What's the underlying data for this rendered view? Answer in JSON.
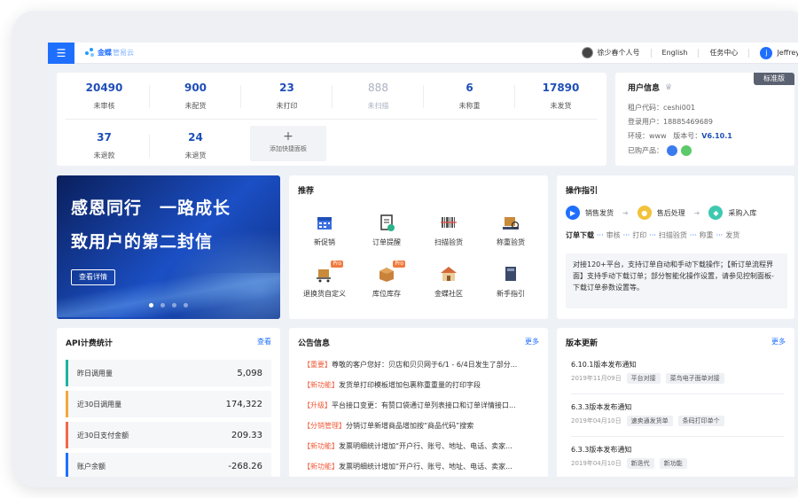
{
  "app": {
    "logo_main": "金蝶",
    "logo_sub": "管易云"
  },
  "topbar": {
    "user_name": "徐少春个人号",
    "language": "English",
    "task_center": "任务中心",
    "account_initial": "j",
    "account_name": "Jeffrey"
  },
  "stats": [
    {
      "value": "20490",
      "label": "未审核"
    },
    {
      "value": "900",
      "label": "未配货"
    },
    {
      "value": "23",
      "label": "未打印"
    },
    {
      "value": "888",
      "label": "未扫描"
    },
    {
      "value": "6",
      "label": "未称重"
    },
    {
      "value": "17890",
      "label": "未发货"
    },
    {
      "value": "37",
      "label": "未退款"
    },
    {
      "value": "24",
      "label": "未退货"
    }
  ],
  "add_panel": {
    "icon": "plus-icon",
    "label": "添加快捷面板"
  },
  "user_info": {
    "title": "用户信息",
    "edition": "标准版",
    "tenant_label": "租户代码：",
    "tenant": "ceshi001",
    "login_label": "登录用户：",
    "login": "18885469689",
    "env_label": "环境：",
    "env": "www",
    "version_label": "版本号：",
    "version": "V6.10.1",
    "products_label": "已购产品："
  },
  "banner": {
    "line1": "感恩同行　一路成长",
    "line2": "致用户的第二封信",
    "button": "查看详情",
    "slides": 4,
    "active_slide": 1
  },
  "recommend": {
    "title": "推荐",
    "items": [
      {
        "label": "新促销",
        "icon": "calendar-icon",
        "color": "#3b6fe0"
      },
      {
        "label": "订单提醒",
        "icon": "order-reminder-icon",
        "color": "#333333"
      },
      {
        "label": "扫描验货",
        "icon": "barcode-icon",
        "color": "#666666"
      },
      {
        "label": "称重验货",
        "icon": "scale-icon",
        "color": "#c98a3a"
      },
      {
        "label": "退换货自定义",
        "icon": "return-cart-icon",
        "color": "#c98a3a",
        "pro": "Pro"
      },
      {
        "label": "库位库存",
        "icon": "box-icon",
        "color": "#c9823a",
        "pro": "Pro"
      },
      {
        "label": "金蝶社区",
        "icon": "community-house-icon",
        "color": "#d46a3a"
      },
      {
        "label": "新手指引",
        "icon": "guide-book-icon",
        "color": "#3b4a6a"
      }
    ]
  },
  "guide": {
    "title": "操作指引",
    "flow": [
      {
        "label": "销售发货",
        "color": "#1f6fff",
        "icon": "truck-icon"
      },
      {
        "label": "售后处理",
        "color": "#f2c23a",
        "icon": "after-sale-icon"
      },
      {
        "label": "采购入库",
        "color": "#3ec9b0",
        "icon": "purchase-icon"
      }
    ],
    "steps": [
      "订单下载",
      "审核",
      "打印",
      "扫描验货",
      "称重",
      "发货"
    ],
    "description": "对接120+平台，支持订单自动和手动下载操作；【新订单流程界面】支持手动下载订单；部分智能化操作设置，请参见控制面板-下载订单参数设置等。"
  },
  "api": {
    "title": "API计费统计",
    "more": "查看",
    "rows": [
      {
        "label": "昨日调用量",
        "value": "5,098",
        "color": "#1fb3a0"
      },
      {
        "label": "近30日调用量",
        "value": "174,322",
        "color": "#f2a93a"
      },
      {
        "label": "近30日支付金额",
        "value": "209.33",
        "color": "#ef6a4a"
      },
      {
        "label": "账户余额",
        "value": "-268.26",
        "color": "#1f6fff"
      }
    ]
  },
  "notice": {
    "title": "公告信息",
    "more": "更多",
    "items": [
      {
        "tag": "【重要】",
        "text": "尊敬的客户您好：贝店和贝贝网于6/1 - 6/4日发生了部分..."
      },
      {
        "tag": "【新功能】",
        "text": "发货单打印模板增加包裹称重重量的打印字段"
      },
      {
        "tag": "【升级】",
        "text": "平台接口变更：有赞口袋通订单列表接口和订单详情接口..."
      },
      {
        "tag": "【分销管理】",
        "text": "分销订单新增商品增加按“商品代码”搜索"
      },
      {
        "tag": "【新功能】",
        "text": "发票明细统计增加“开户行、账号、地址、电话、卖家..."
      },
      {
        "tag": "【新功能】",
        "text": "发票明细统计增加“开户行、账号、地址、电话、卖家..."
      }
    ]
  },
  "updates": {
    "title": "版本更新",
    "more": "更多",
    "items": [
      {
        "title": "6.10.1版本发布通知",
        "date": "2019年11月09日",
        "tags": [
          "平台对接",
          "菜鸟电子面单对接"
        ]
      },
      {
        "title": "6.3.3版本发布通知",
        "date": "2019年04月10日",
        "tags": [
          "速卖通发货单",
          "条码打印单个"
        ]
      },
      {
        "title": "6.3.3版本发布通知",
        "date": "2019年04月10日",
        "tags": [
          "新迭代",
          "新功能"
        ]
      }
    ]
  }
}
